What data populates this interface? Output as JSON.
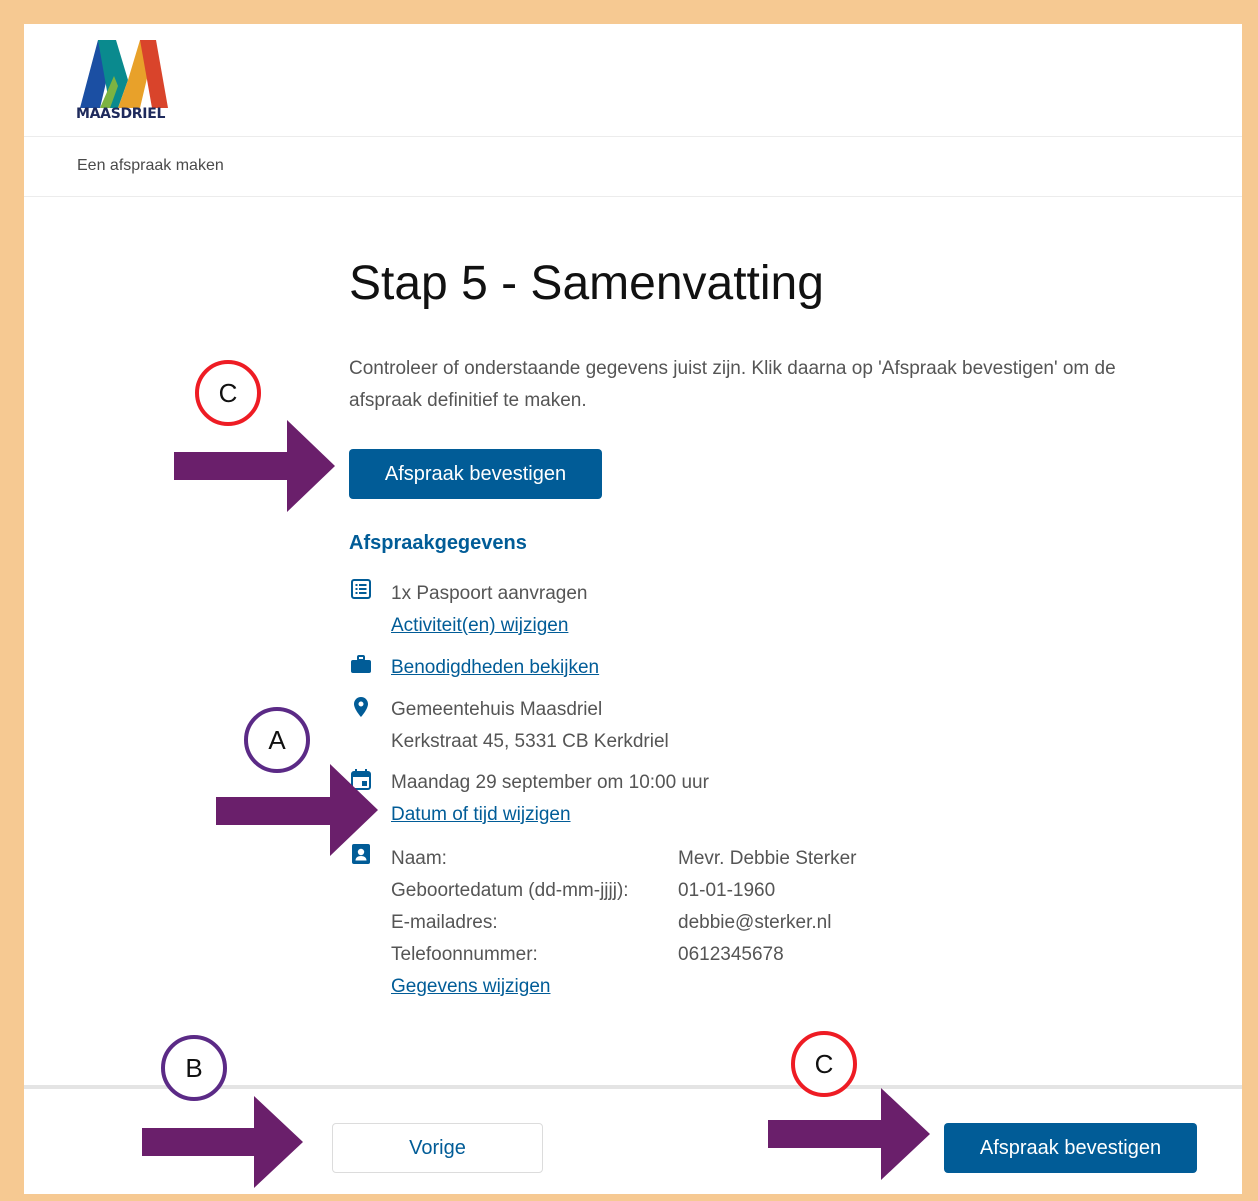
{
  "brand": {
    "name": "MAASDRIEL"
  },
  "breadcrumb": "Een afspraak maken",
  "page": {
    "title": "Stap 5 - Samenvatting",
    "intro": "Controleer of onderstaande gegevens juist zijn. Klik daarna op 'Afspraak bevestigen' om de afspraak definitief te maken.",
    "confirm_label": "Afspraak bevestigen"
  },
  "details": {
    "section_title": "Afspraakgegevens",
    "activity": "1x Paspoort aanvragen",
    "activity_link": "Activiteit(en) wijzigen",
    "requirements_link": "Benodigdheden bekijken",
    "location_name": "Gemeentehuis Maasdriel",
    "location_address": "Kerkstraat 45, 5331 CB Kerkdriel",
    "datetime": "Maandag 29 september om 10:00 uur",
    "datetime_link": "Datum of tijd wijzigen",
    "personal": [
      {
        "label": "Naam:",
        "value": "Mevr. Debbie Sterker"
      },
      {
        "label": "Geboortedatum (dd-mm-jjjj):",
        "value": "01-01-1960"
      },
      {
        "label": "E-mailadres:",
        "value": "debbie@sterker.nl"
      },
      {
        "label": "Telefoonnummer:",
        "value": "0612345678"
      }
    ],
    "personal_link": "Gegevens wijzigen"
  },
  "footer": {
    "previous_label": "Vorige",
    "confirm_label": "Afspraak bevestigen"
  },
  "annotations": {
    "marker_a": "A",
    "marker_b": "B",
    "marker_c_top": "C",
    "marker_c_bottom": "C"
  },
  "colors": {
    "primary": "#015c97",
    "frame": "#f6c992",
    "arrow": "#6a1f6b",
    "marker_red": "#ee1c24",
    "marker_purple": "#5b2a86"
  }
}
